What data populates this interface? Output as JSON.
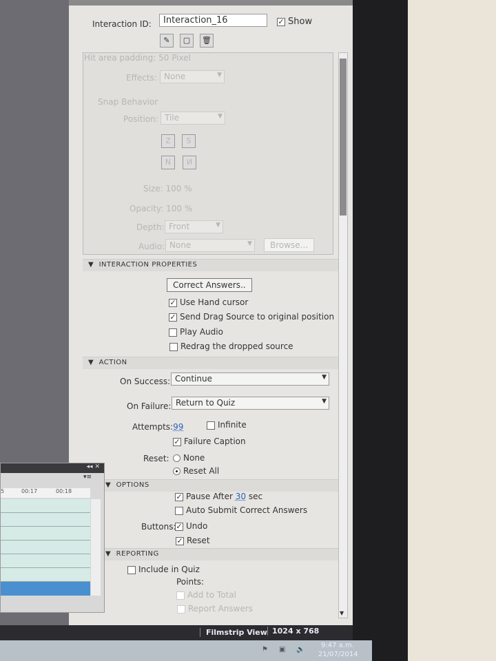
{
  "header": {
    "interaction_id_label": "Interaction ID:",
    "interaction_id_value": "Interaction_16",
    "show_label": "Show",
    "show_checked": true
  },
  "appearance": {
    "hit_area_label": "Hit area padding:",
    "hit_area_value": "50",
    "hit_area_unit": "Pixel",
    "effects_label": "Effects:",
    "effects_value": "None"
  },
  "snap": {
    "title": "Snap Behavior",
    "position_label": "Position:",
    "position_value": "Tile",
    "size_label": "Size:",
    "size_value": "100",
    "opacity_label": "Opacity:",
    "opacity_value": "100",
    "percent": "%",
    "depth_label": "Depth:",
    "depth_value": "Front",
    "audio_label": "Audio:",
    "audio_value": "None",
    "browse_label": "Browse..."
  },
  "interaction_properties": {
    "title": "INTERACTION PROPERTIES",
    "correct_answers_button": "Correct Answers..",
    "options": [
      {
        "label": "Use Hand cursor",
        "checked": true
      },
      {
        "label": "Send Drag Source to original position",
        "checked": true
      },
      {
        "label": "Play Audio",
        "checked": false
      },
      {
        "label": "Redrag the dropped source",
        "checked": false
      }
    ]
  },
  "action": {
    "title": "ACTION",
    "on_success_label": "On Success:",
    "on_success_value": "Continue",
    "on_failure_label": "On Failure:",
    "on_failure_value": "Return to Quiz",
    "attempts_label": "Attempts:",
    "attempts_value": "99",
    "infinite_label": "Infinite",
    "infinite_checked": false,
    "failure_caption_label": "Failure Caption",
    "failure_caption_checked": true,
    "reset_label": "Reset:",
    "reset_options": [
      "None",
      "Reset All"
    ],
    "reset_selected": "Reset All"
  },
  "options": {
    "title": "OPTIONS",
    "pause_after_label": "Pause After",
    "pause_after_value": "30",
    "pause_after_unit": "sec",
    "pause_checked": true,
    "auto_submit_label": "Auto Submit Correct Answers",
    "auto_submit_checked": false,
    "buttons_label": "Buttons:",
    "undo_label": "Undo",
    "undo_checked": true,
    "reset_btn_label": "Reset",
    "reset_checked": true
  },
  "reporting": {
    "title": "REPORTING",
    "include_in_quiz_label": "Include in Quiz",
    "include_checked": false,
    "points_label": "Points:",
    "add_to_total_label": "Add to Total",
    "report_answers_label": "Report Answers"
  },
  "timeline": {
    "ticks": [
      "00:17",
      "00:18"
    ],
    "tick_partial": "5"
  },
  "status_bar": {
    "view": "Filmstrip View",
    "resolution": "1024 x 768"
  },
  "taskbar": {
    "time": "9:47 a.m.",
    "date": "21/07/2014"
  },
  "colors": {
    "accent_link": "#2a62b8",
    "selected_row": "#4a8fd0"
  }
}
